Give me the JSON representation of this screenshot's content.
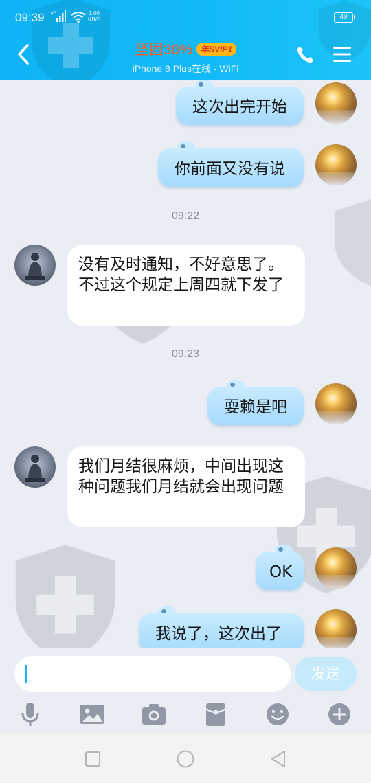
{
  "status_bar": {
    "time": "09:39",
    "network": "4G",
    "speed_value": "1.00",
    "speed_unit": "KB/S",
    "battery": "49"
  },
  "header": {
    "contact_name": "坚固30%",
    "badge": "年SVIP1",
    "status": "iPhone 8 Plus在线 - WiFi"
  },
  "messages": [
    {
      "from": "me",
      "text": "这次出完开始"
    },
    {
      "from": "me",
      "text": "你前面又没有说"
    },
    {
      "type": "timestamp",
      "text": "09:22"
    },
    {
      "from": "them",
      "text": "没有及时通知，不好意思了。不过这个规定上周四就下发了"
    },
    {
      "type": "timestamp",
      "text": "09:23"
    },
    {
      "from": "me",
      "text": "耍赖是吧"
    },
    {
      "from": "them",
      "text": "我们月结很麻烦，中间出现这种问题我们月结就会出现问题"
    },
    {
      "from": "me",
      "text": "OK"
    },
    {
      "from": "me",
      "text": "我说了，这次出了"
    }
  ],
  "input": {
    "value": "",
    "send_label": "发送"
  },
  "toolbar": {
    "icons": [
      "microphone-icon",
      "image-icon",
      "camera-icon",
      "red-packet-icon",
      "emoji-icon",
      "plus-icon"
    ]
  },
  "nav": {
    "icons": [
      "recent-apps-icon",
      "home-icon",
      "back-icon"
    ]
  },
  "colors": {
    "header": "#12b9f7",
    "bubble_me": "#b5e1fe",
    "bubble_them": "#ffffff",
    "background": "#eaedf4",
    "contact_name": "#ff5a1e",
    "badge": "#ffb61b"
  }
}
